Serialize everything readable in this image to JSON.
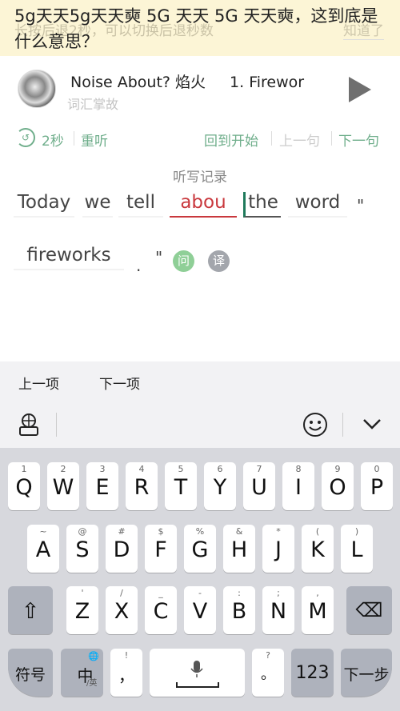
{
  "overlay_title": "5g天天5g天天奭 5G 天天 5G 天天奭，这到底是什么意思？",
  "banner": {
    "hint": "长按后退2秒，可以切换后退秒数",
    "dismiss": "知道了"
  },
  "player": {
    "title": "Noise About? 焰火",
    "episode": "1. Firewor",
    "subtitle": "词汇掌故",
    "play_icon": "play-icon"
  },
  "controls": {
    "rewind": "2秒",
    "replay": "重听",
    "restart": "回到开始",
    "prev": "上一句",
    "next": "下一句"
  },
  "colors": {
    "accent": "#6fae8b",
    "error": "#c9383d",
    "active": "#1f7a5c"
  },
  "dictation": {
    "label": "听写记录",
    "words": [
      "Today",
      "we",
      "tell",
      "abou",
      "the",
      "word",
      "fireworks"
    ],
    "punct": [
      "\"",
      ".",
      "\""
    ],
    "incorrect_word": "abou",
    "active_word": "the",
    "hint_button": "问",
    "translate_button": "译"
  },
  "nav": {
    "prev": "上一项",
    "next": "下一项"
  },
  "keyboard": {
    "row1": [
      [
        "1",
        "Q"
      ],
      [
        "2",
        "W"
      ],
      [
        "3",
        "E"
      ],
      [
        "4",
        "R"
      ],
      [
        "5",
        "T"
      ],
      [
        "6",
        "Y"
      ],
      [
        "7",
        "U"
      ],
      [
        "8",
        "I"
      ],
      [
        "9",
        "O"
      ],
      [
        "0",
        "P"
      ]
    ],
    "row2": [
      [
        "~",
        "A"
      ],
      [
        "@",
        "S"
      ],
      [
        "#",
        "D"
      ],
      [
        "$",
        "F"
      ],
      [
        "%",
        "G"
      ],
      [
        "&",
        "H"
      ],
      [
        "*",
        "J"
      ],
      [
        "(",
        "K"
      ],
      [
        ")",
        "L"
      ]
    ],
    "row3": [
      [
        "'",
        "Z"
      ],
      [
        "/",
        "X"
      ],
      [
        "_",
        "C"
      ],
      [
        "-",
        "V"
      ],
      [
        ":",
        "B"
      ],
      [
        ";",
        "N"
      ],
      [
        ",",
        "M"
      ]
    ],
    "symbols": "符号",
    "lang": "中",
    "lang_sub": "/英",
    "comma": "，",
    "comma_sub": "!",
    "period": "。",
    "period_sub": "?",
    "numbers": "123",
    "next": "下一步"
  }
}
